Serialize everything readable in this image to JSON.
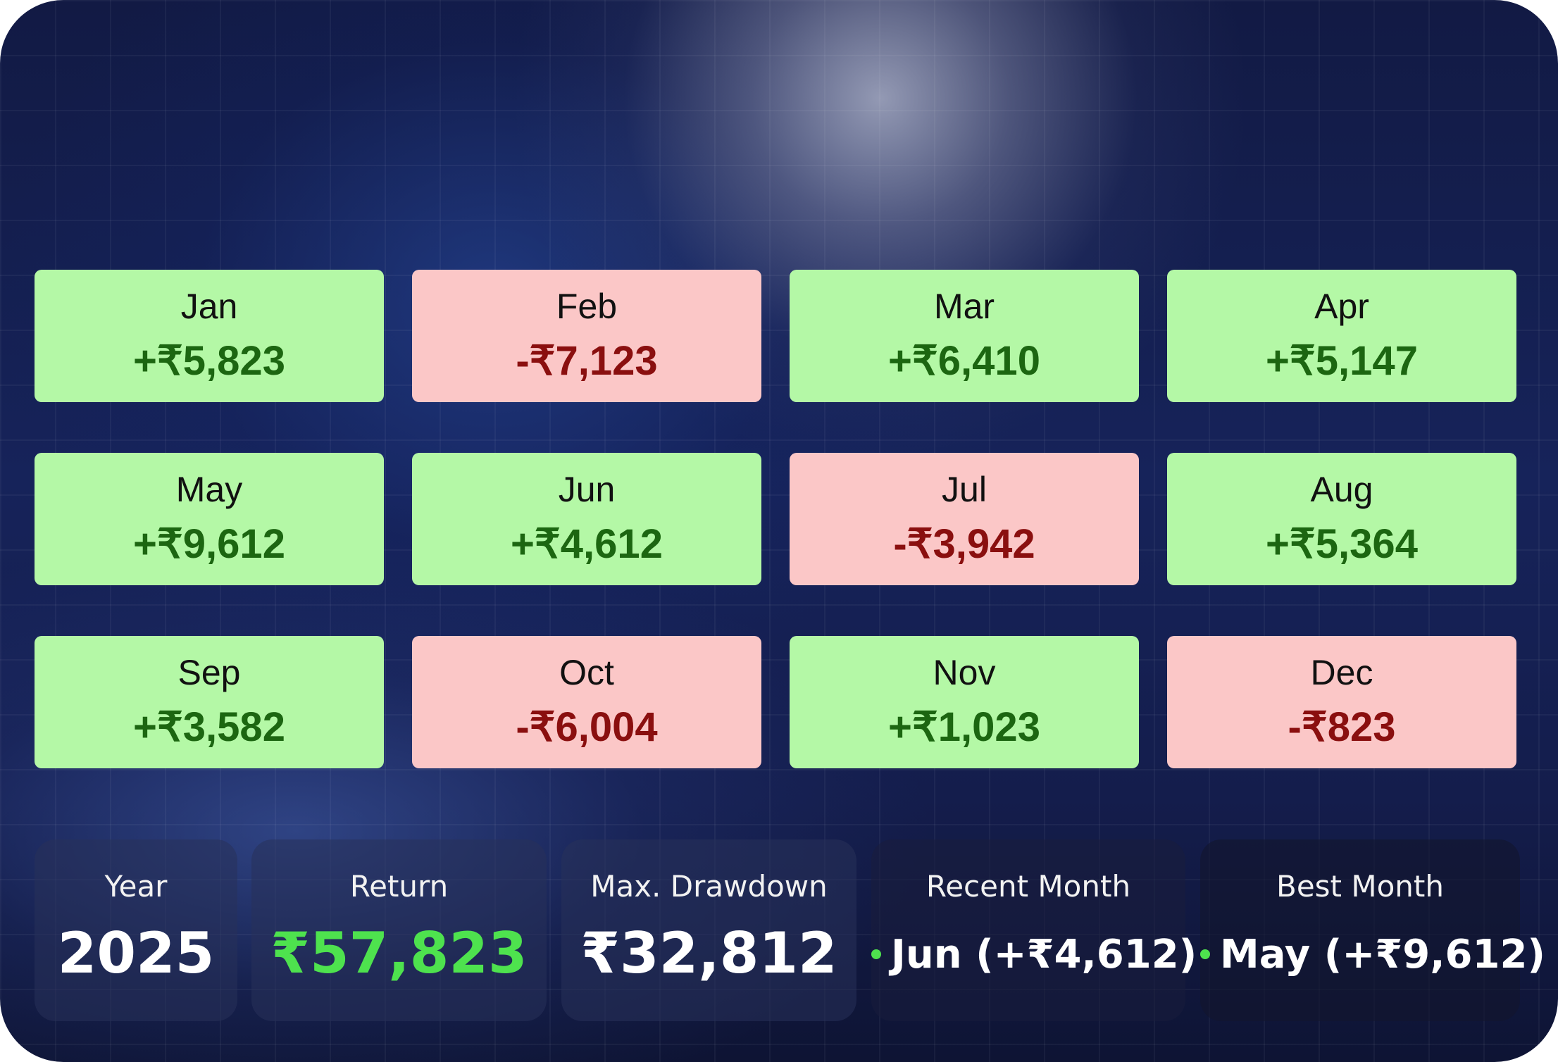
{
  "months": [
    {
      "name": "Jan",
      "value": "+₹5,823"
    },
    {
      "name": "Feb",
      "value": "-₹7,123"
    },
    {
      "name": "Mar",
      "value": "+₹6,410"
    },
    {
      "name": "Apr",
      "value": "+₹5,147"
    },
    {
      "name": "May",
      "value": "+₹9,612"
    },
    {
      "name": "Jun",
      "value": "+₹4,612"
    },
    {
      "name": "Jul",
      "value": "-₹3,942"
    },
    {
      "name": "Aug",
      "value": "+₹5,364"
    },
    {
      "name": "Sep",
      "value": "+₹3,582"
    },
    {
      "name": "Oct",
      "value": "-₹6,004"
    },
    {
      "name": "Nov",
      "value": "+₹1,023"
    },
    {
      "name": "Dec",
      "value": "-₹823"
    }
  ],
  "stats": {
    "year": {
      "label": "Year",
      "value": "2025"
    },
    "return": {
      "label": "Return",
      "value": "₹57,823"
    },
    "max_drawdown": {
      "label": "Max. Drawdown",
      "value": "₹32,812"
    },
    "recent_month": {
      "label": "Recent Month",
      "value": "Jun (+₹4,612)"
    },
    "best_month": {
      "label": "Best Month",
      "value": "May (+₹9,612)"
    }
  },
  "colors": {
    "positive_bg": "#b4f8a6",
    "negative_bg": "#fbc7c7",
    "positive_text": "#1c6611",
    "negative_text": "#8a0f0f",
    "accent_green": "#4ee24e"
  }
}
